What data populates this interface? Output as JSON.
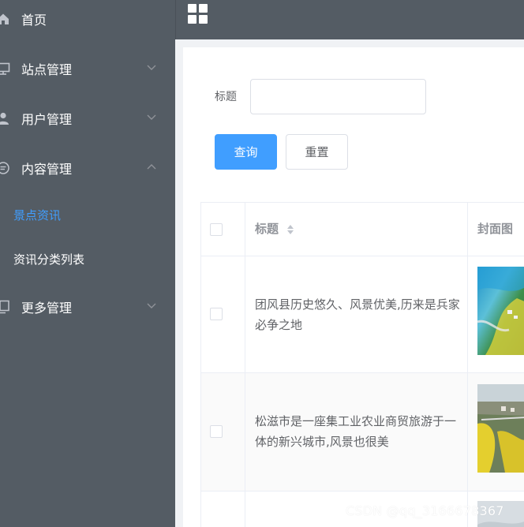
{
  "sidebar": {
    "items": [
      {
        "label": "首页",
        "icon": "home-icon"
      },
      {
        "label": "站点管理",
        "icon": "monitor-icon",
        "arrow": "chevron-down-icon"
      },
      {
        "label": "用户管理",
        "icon": "user-icon",
        "arrow": "chevron-down-icon"
      },
      {
        "label": "内容管理",
        "icon": "message-icon",
        "arrow": "chevron-up-icon"
      },
      {
        "label": "更多管理",
        "icon": "copy-icon",
        "arrow": "chevron-down-icon"
      }
    ],
    "subitems": [
      {
        "label": "景点资讯",
        "active": true
      },
      {
        "label": "资讯分类列表",
        "active": false
      }
    ]
  },
  "topbar": {
    "icon": "grid-menu-icon"
  },
  "search": {
    "title_label": "标题",
    "title_value": "",
    "query_button": "查询",
    "reset_button": "重置"
  },
  "table": {
    "columns": [
      "标题",
      "封面图"
    ],
    "rows": [
      {
        "title": "团风县历史悠久、风景优美,历来是兵家必争之地"
      },
      {
        "title": "松滋市是一座集工业农业商贸旅游于一体的新兴城市,风景也很美"
      }
    ]
  },
  "watermark": "CSDN @qq_3166678367",
  "colors": {
    "sidebar_bg": "#545c64",
    "accent": "#409eff",
    "text": "#606266",
    "header_text": "#909399"
  }
}
